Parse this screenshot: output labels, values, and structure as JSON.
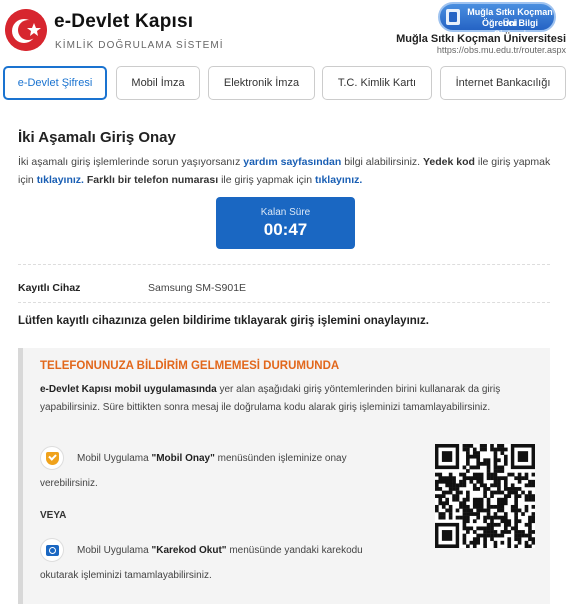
{
  "header": {
    "title": "e-Devlet Kapısı",
    "subtitle": "KİMLİK DOĞRULAMA SİSTEMİ",
    "uni_badge_line1": "Muğla Sıtkı Koçman Üni",
    "uni_badge_line2": "Öğrenci Bilgi Sistemi",
    "uni_name": "Muğla Sıtkı Koçman Üniversitesi",
    "uni_url": "https://obs.mu.edu.tr/router.aspx"
  },
  "tabs": [
    {
      "label": "e-Devlet Şifresi",
      "active": true
    },
    {
      "label": "Mobil İmza",
      "active": false
    },
    {
      "label": "Elektronik İmza",
      "active": false
    },
    {
      "label": "T.C. Kimlik Kartı",
      "active": false
    },
    {
      "label": "İnternet Bankacılığı",
      "active": false
    }
  ],
  "main": {
    "heading": "İki Aşamalı Giriş Onay",
    "intro_1": "İki aşamalı giriş işlemlerinde sorun yaşıyorsanız ",
    "intro_link_help": "yardım sayfasından",
    "intro_2": " bilgi alabilirsiniz. ",
    "intro_backup_bold": "Yedek kod",
    "intro_3": " ile giriş yapmak için ",
    "intro_link_click1": "tıklayınız.",
    "intro_4": " Farklı bir telefon numarası",
    "intro_5": " ile giriş yapmak için ",
    "intro_link_click2": "tıklayınız.",
    "timer_label": "Kalan Süre",
    "timer_value": "00:47",
    "device_label": "Kayıtlı Cihaz",
    "device_value": "Samsung SM-S901E",
    "confirm_text": "Lütfen kayıtlı cihazınıza gelen bildirime tıklayarak giriş işlemini onaylayınız."
  },
  "infobox": {
    "title": "TELEFONUNUZA BİLDİRİM GELMEMESİ DURUMUNDA",
    "text_bold": "e-Devlet Kapısı mobil uygulamasında",
    "text_rest": " yer alan aşağıdaki giriş yöntemlerinden birini kullanarak da giriş yapabilirsiniz. Süre bittikten sonra mesaj ile doğrulama kodu alarak giriş işleminizi tamamlayabilirsiniz.",
    "opt1_pre": "Mobil Uygulama ",
    "opt1_bold": "\"Mobil Onay\"",
    "opt1_post": " menüsünden işleminize onay",
    "opt1_line2": "verebilirsiniz.",
    "veya": "VEYA",
    "opt2_pre": "Mobil Uygulama ",
    "opt2_bold": "\"Karekod Okut\"",
    "opt2_post": " menüsünde yandaki karekodu",
    "opt2_line2": "okutarak işleminizi tamamlayabilirsiniz."
  },
  "icons": {
    "logo": "crescent-star-logo",
    "opt1": "shield-check-icon",
    "opt2": "camera-icon",
    "qr": "qr-code"
  },
  "colors": {
    "brand_red": "#d7262f",
    "link_blue": "#1a5fb4",
    "timer_blue": "#1a67c2",
    "warning_orange": "#e2671b"
  }
}
